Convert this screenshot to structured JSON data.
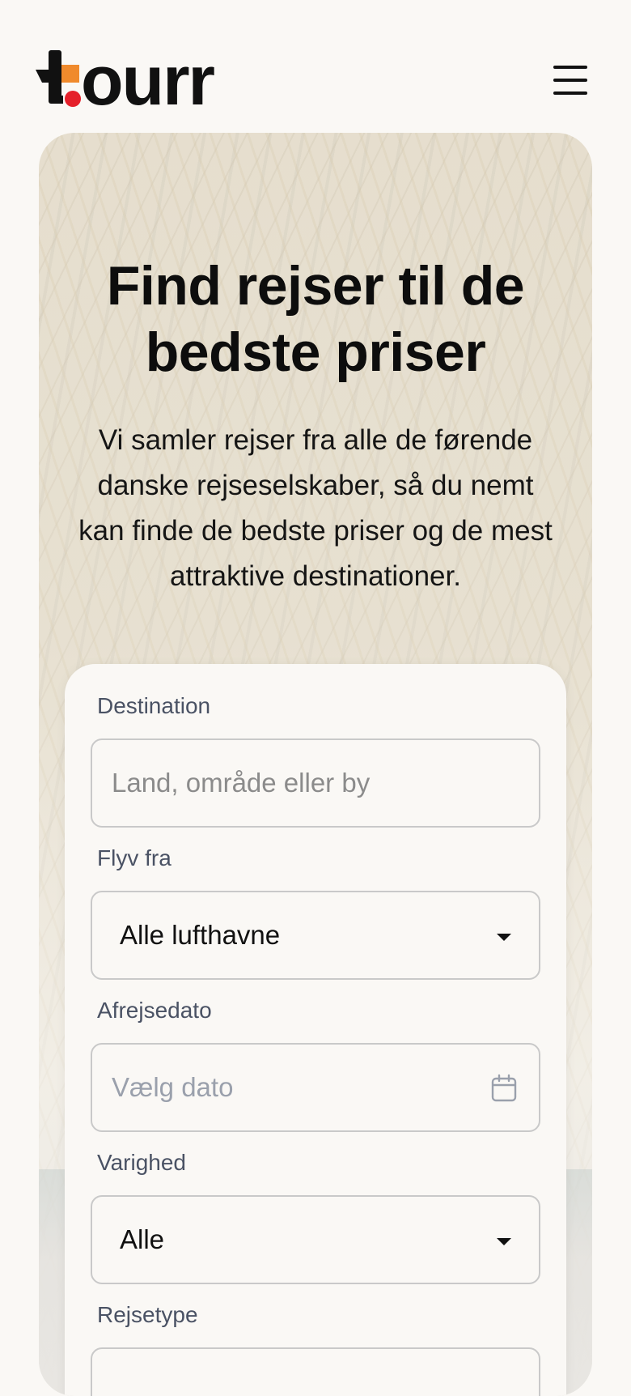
{
  "brand": {
    "name": "tourr",
    "colors": {
      "accent_orange": "#f08a2c",
      "accent_red": "#e5202a",
      "ink": "#111111"
    }
  },
  "header": {
    "menu_icon": "hamburger-menu-icon"
  },
  "hero": {
    "title": "Find rejser til de bedste priser",
    "subtitle": "Vi samler rejser fra alle de førende danske rejseselskaber, så du nemt kan finde de bedste priser og de mest attraktive destinationer."
  },
  "search": {
    "destination": {
      "label": "Destination",
      "placeholder": "Land, område eller by",
      "value": ""
    },
    "departure": {
      "label": "Flyv fra",
      "value": "Alle lufthavne"
    },
    "date": {
      "label": "Afrejsedato",
      "placeholder": "Vælg dato",
      "icon": "calendar-icon"
    },
    "duration": {
      "label": "Varighed",
      "value": "Alle"
    },
    "trip_type": {
      "label": "Rejsetype"
    }
  }
}
